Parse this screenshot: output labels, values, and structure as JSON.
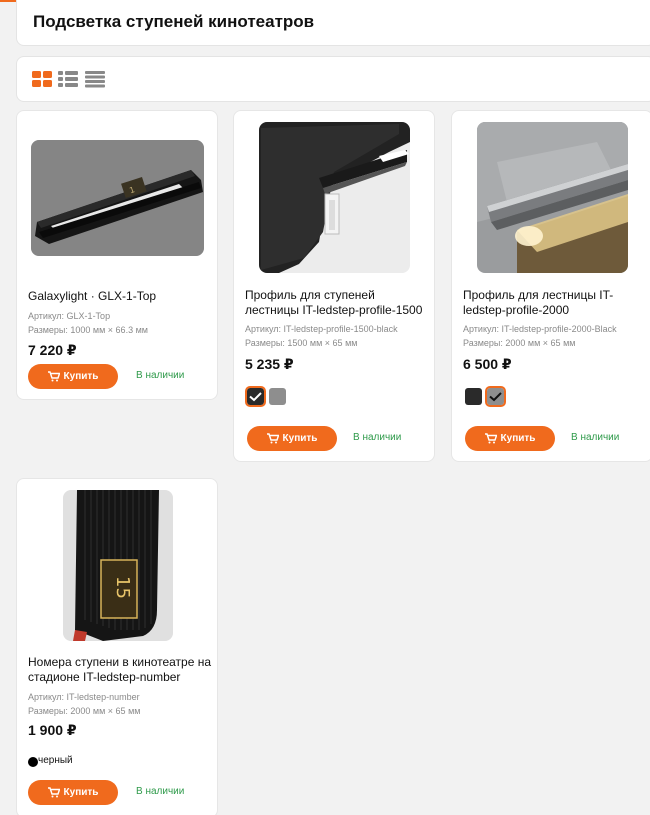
{
  "page": {
    "title": "Подсветка ступеней кинотеатров"
  },
  "view_toggle": {
    "icons": [
      "grid-view-icon",
      "list-view-icon",
      "table-view-icon"
    ]
  },
  "colors": {
    "accent": "#f06a1d",
    "in_stock": "#2e9a4a"
  },
  "products": [
    {
      "name": "Galaxylight · GLX-1-Top",
      "sku": "Артикул: GLX-1-Top",
      "size": "Размеры: 1000 мм × 66.3 мм",
      "price": "7 220 ₽",
      "buy_label": "Купить",
      "stock_label": "В наличии"
    },
    {
      "name": "Профиль для ступеней лестницы IT-ledstep-profile-1500",
      "sku": "Артикул: IT-ledstep-profile-1500-black",
      "size": "Размеры: 1500 мм × 65 мм",
      "price": "5 235 ₽",
      "buy_label": "Купить",
      "stock_label": "В наличии",
      "swatches": [
        "black",
        "gray"
      ]
    },
    {
      "name": "Профиль для лестницы IT-ledstep-profile-2000",
      "sku": "Артикул: IT-ledstep-profile-2000-Black",
      "size": "Размеры: 2000 мм × 65 мм",
      "price": "6 500 ₽",
      "buy_label": "Купить",
      "stock_label": "В наличии",
      "swatches": [
        "black",
        "gray"
      ]
    },
    {
      "name": "Номера ступени в кинотеатре на стадионе IT-ledstep-number",
      "sku": "Артикул: IT-ledstep-number",
      "size": "Размеры: 2000 мм × 65 мм",
      "price": "1 900 ₽",
      "color_label": "черный",
      "buy_label": "Купить",
      "stock_label": "В наличии"
    }
  ]
}
